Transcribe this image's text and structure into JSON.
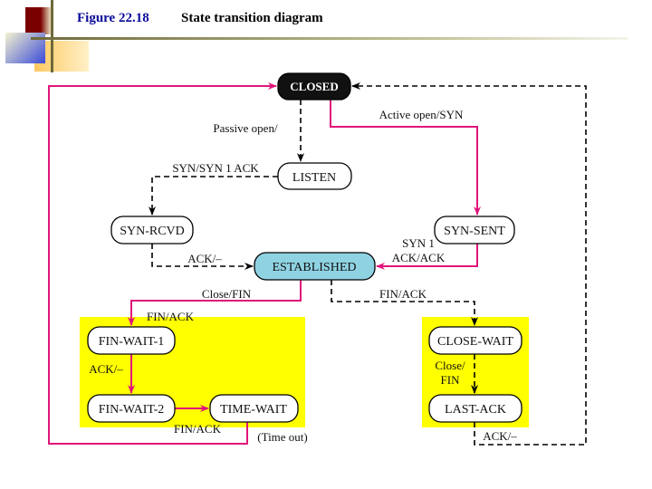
{
  "header": {
    "figure_number": "Figure 22.18",
    "title": "State transition diagram"
  },
  "colors": {
    "active_path": "#e0157a",
    "passive_path": "#000000",
    "established_fill": "#8fd3e3",
    "closed_fill": "#111111",
    "highlight_region": "#ffff00",
    "figure_number": "#0a0a9a"
  },
  "states": {
    "closed": "CLOSED",
    "listen": "LISTEN",
    "syn_rcvd": "SYN-RCVD",
    "syn_sent": "SYN-SENT",
    "established": "ESTABLISHED",
    "fin_wait_1": "FIN-WAIT-1",
    "fin_wait_2": "FIN-WAIT-2",
    "time_wait": "TIME-WAIT",
    "close_wait": "CLOSE-WAIT",
    "last_ack": "LAST-ACK"
  },
  "transitions": {
    "passive_open": "Passive open/",
    "active_open": "Active open/SYN",
    "syn_synack": "SYN/SYN 1 ACK",
    "ack_none_rcvd": "ACK/–",
    "syn1": "SYN 1",
    "ack_ack": "ACK/ACK",
    "close_fin": "Close/FIN",
    "fin_ack_passive": "FIN/ACK",
    "fin_ack_fw1": "FIN/ACK",
    "ack_none_fw1": "ACK/–",
    "fin_ack_fw2": "FIN/ACK",
    "time_out": "(Time out)",
    "close_slash": "Close/",
    "fin": "FIN",
    "ack_none_last": "ACK/–"
  }
}
